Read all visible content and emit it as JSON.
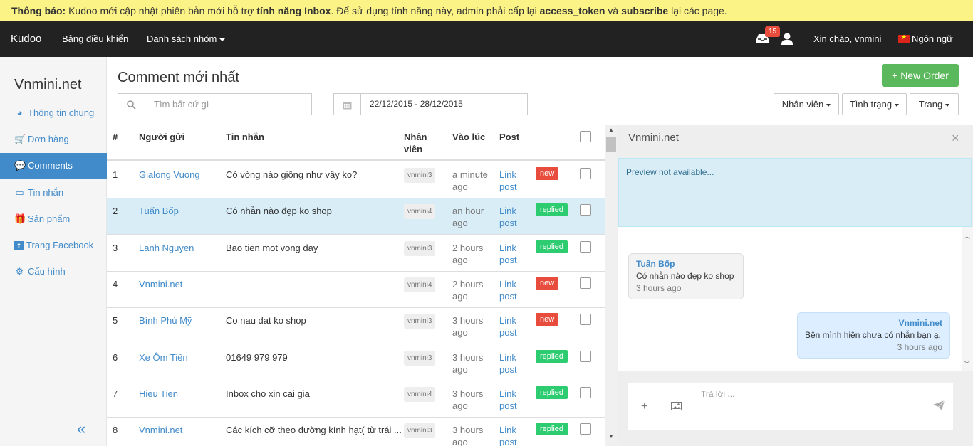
{
  "notice": {
    "label": "Thông báo:",
    "text1": " Kudoo mới cập nhật phiên bản mới hỗ trợ ",
    "bold1": "tính năng Inbox",
    "text2": ". Để sử dụng tính năng này, admin phải cấp lại ",
    "bold2": "access_token",
    "text3": " và ",
    "bold3": "subscribe",
    "text4": " lại các page."
  },
  "topnav": {
    "brand": "Kudoo",
    "dashboard": "Bảng điều khiển",
    "groups": "Danh sách nhóm",
    "notif_count": "15",
    "greeting": "Xin chào, vnmini",
    "language": "Ngôn ngữ"
  },
  "sidebar": {
    "site": "Vnmini.net",
    "items": [
      {
        "label": "Thông tin chung",
        "icon": "dashboard-icon"
      },
      {
        "label": "Đơn hàng",
        "icon": "cart-icon"
      },
      {
        "label": "Comments",
        "icon": "comments-icon"
      },
      {
        "label": "Tin nhắn",
        "icon": "inbox-icon"
      },
      {
        "label": "Sản phẩm",
        "icon": "gift-icon"
      },
      {
        "label": "Trang Facebook",
        "icon": "facebook-icon"
      },
      {
        "label": "Cấu hình",
        "icon": "gear-icon"
      }
    ],
    "active_index": 2,
    "collapse_glyph": "«"
  },
  "main": {
    "title": "Comment mới nhất",
    "new_order": "New Order",
    "search_placeholder": "Tìm bất cứ gì",
    "date_range": "22/12/2015 - 28/12/2015",
    "filters": [
      "Nhân viên",
      "Tình trạng",
      "Trang"
    ]
  },
  "table": {
    "headers": {
      "num": "#",
      "sender": "Người gửi",
      "message": "Tin nhắn",
      "staff_1": "Nhân",
      "staff_2": "viên",
      "time": "Vào lúc",
      "post": "Post"
    },
    "rows": [
      {
        "num": "1",
        "sender": "Gialong Vuong",
        "message": "Có vòng nào giống như vậy ko?",
        "staff": "vnmini3",
        "time1": "a minute",
        "time2": "ago",
        "link1": "Link",
        "link2": "post",
        "status": "new"
      },
      {
        "num": "2",
        "sender": "Tuấn Bốp",
        "message": "Có nhẫn nào đẹp ko shop",
        "staff": "vnmini4",
        "time1": "an hour",
        "time2": "ago",
        "link1": "Link",
        "link2": "post",
        "status": "replied"
      },
      {
        "num": "3",
        "sender": "Lanh Nguyen",
        "message": "Bao tien mot vong day",
        "staff": "vnmini3",
        "time1": "2 hours",
        "time2": "ago",
        "link1": "Link",
        "link2": "post",
        "status": "replied"
      },
      {
        "num": "4",
        "sender": "Vnmini.net",
        "message": "",
        "staff": "vnmini4",
        "time1": "2 hours",
        "time2": "ago",
        "link1": "Link",
        "link2": "post",
        "status": "new"
      },
      {
        "num": "5",
        "sender": "Bình Phú Mỹ",
        "message": "Co nau dat ko shop",
        "staff": "vnmini3",
        "time1": "3 hours",
        "time2": "ago",
        "link1": "Link",
        "link2": "post",
        "status": "new"
      },
      {
        "num": "6",
        "sender": "Xe Ôm Tiến",
        "message": "01649 979 979",
        "staff": "vnmini3",
        "time1": "3 hours",
        "time2": "ago",
        "link1": "Link",
        "link2": "post",
        "status": "replied"
      },
      {
        "num": "7",
        "sender": "Hieu Tien",
        "message": "Inbox cho xin cai gia",
        "staff": "vnmini4",
        "time1": "3 hours",
        "time2": "ago",
        "link1": "Link",
        "link2": "post",
        "status": "replied"
      },
      {
        "num": "8",
        "sender": "Vnmini.net",
        "message": "Các kích cỡ theo đường kính hạt( từ trái ...",
        "staff": "vnmini3",
        "time1": "3 hours",
        "time2": "ago",
        "link1": "Link",
        "link2": "post",
        "status": "replied"
      }
    ],
    "highlight_index": 1
  },
  "panel": {
    "title": "Vnmini.net",
    "close": "×",
    "preview": "Preview not available...",
    "messages": [
      {
        "who": "Tuấn Bốp",
        "body": "Có nhẫn nào đẹp ko shop",
        "time": "3 hours ago",
        "dir": "in"
      },
      {
        "who": "Vnmini.net",
        "body": "Bên mình hiện chưa có nhẫn bạn ạ.",
        "time": "3 hours ago",
        "dir": "out"
      }
    ],
    "reply_placeholder": "Trả lời ..."
  },
  "colors": {
    "primary": "#428bca",
    "success": "#5cb85c",
    "new": "#e74c3c",
    "replied": "#2ecc71",
    "notice_bg": "#fbf386",
    "nav_bg": "#222222"
  }
}
